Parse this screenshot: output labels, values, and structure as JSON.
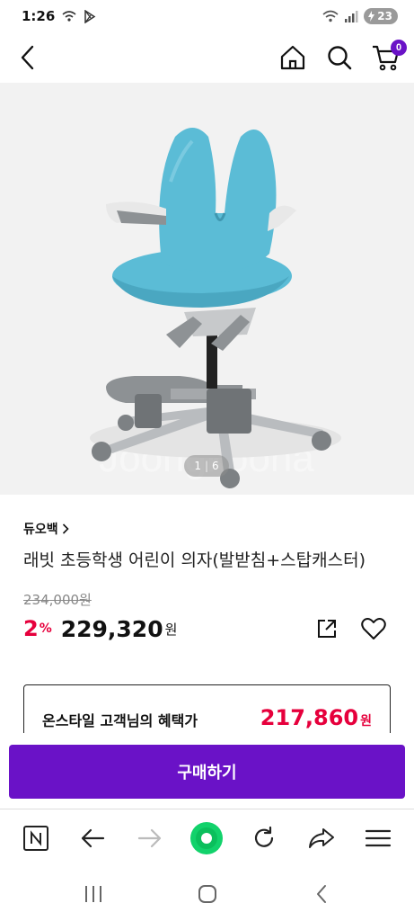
{
  "status_bar": {
    "time": "1:26",
    "battery": "23"
  },
  "header": {
    "cart_count": "0"
  },
  "gallery": {
    "current": "1",
    "total": "6",
    "watermark": "Joongkoona"
  },
  "product": {
    "brand": "듀오백",
    "title": "래빗 초등학생 어린이 의자(발받침+스탑캐스터)",
    "original_price": "234,000원",
    "discount": "2",
    "discount_unit": "%",
    "price": "229,320",
    "price_unit": "원"
  },
  "benefit": {
    "label": "온스타일 고객님의 혜택가",
    "price": "217,860",
    "unit": "원"
  },
  "buy_button": "구매하기",
  "colors": {
    "accent": "#6a12c7",
    "sale": "#e6003c",
    "chair_blue": "#5bbcd6"
  },
  "browser_toolbar": [
    "naver-icon",
    "back-icon",
    "forward-icon",
    "home-green-icon",
    "refresh-icon",
    "share-icon",
    "menu-icon"
  ],
  "system_nav": [
    "recent-apps-icon",
    "home-icon",
    "back-icon"
  ]
}
